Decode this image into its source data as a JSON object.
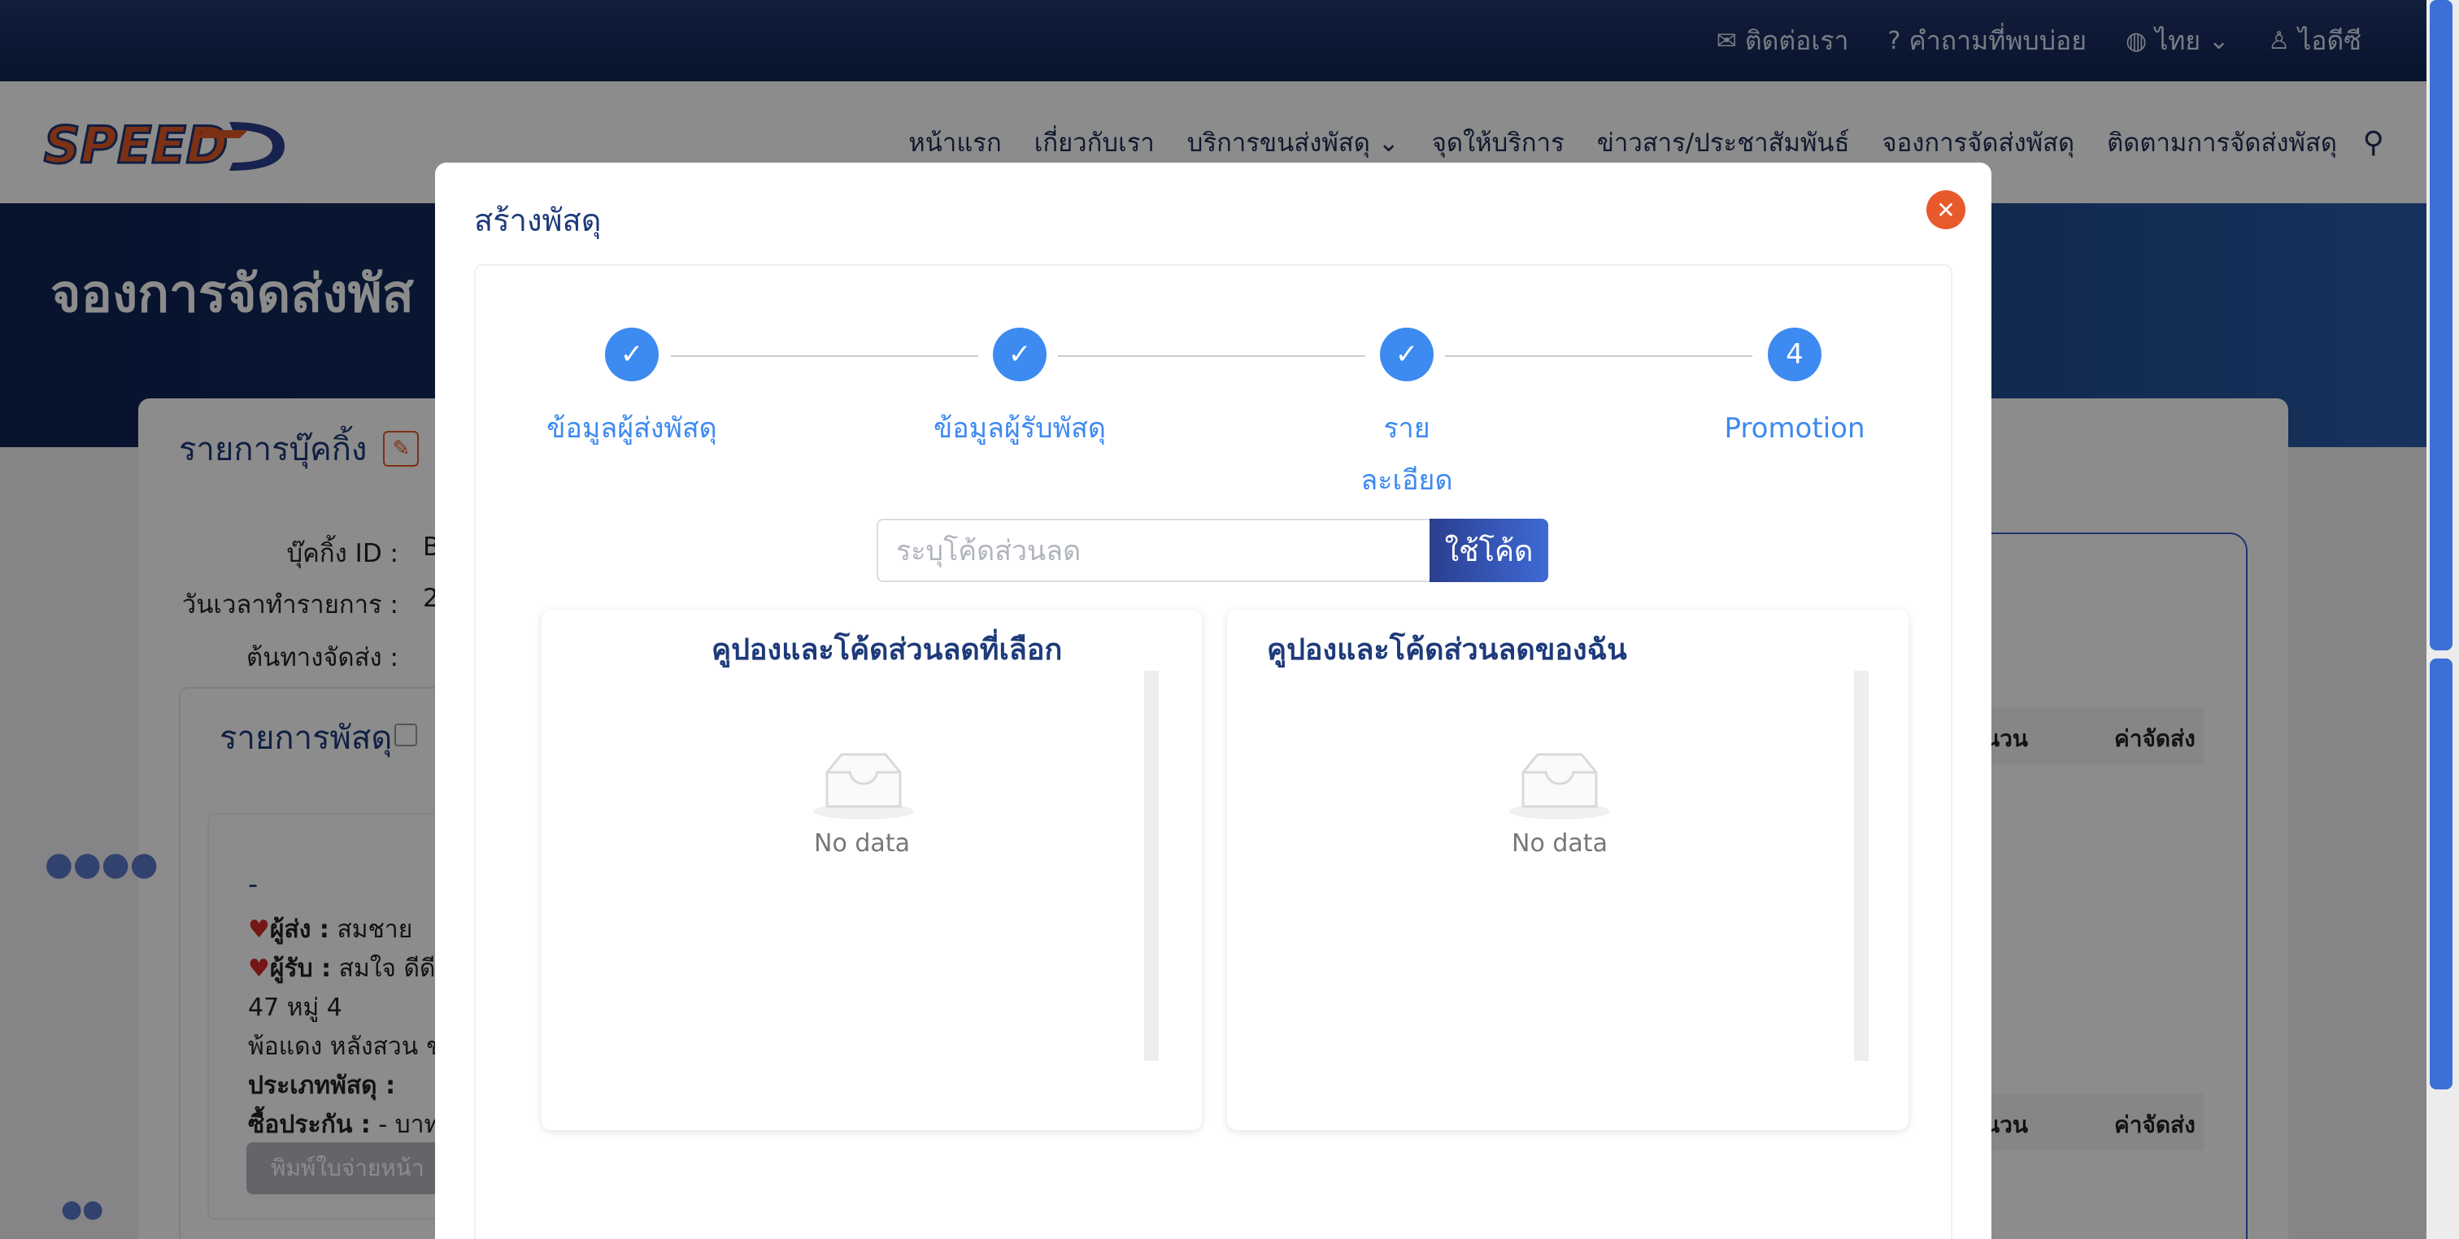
{
  "topbar": {
    "contact": "ติดต่อเรา",
    "faq": "คำถามที่พบบ่อย",
    "language": "ไทย",
    "account": "ไอดีซี"
  },
  "nav": {
    "logo_text": "SPEED-D",
    "items": [
      "หน้าแรก",
      "เกี่ยวกับเรา",
      "บริการขนส่งพัสดุ",
      "จุดให้บริการ",
      "ข่าวสาร/ประชาสัมพันธ์",
      "จองการจัดส่งพัสดุ",
      "ติดตามการจัดส่งพัสดุ"
    ]
  },
  "hero": {
    "title": "จองการจัดส่งพัส"
  },
  "booking": {
    "header": "รายการบุ๊คกิ้ง",
    "labels": [
      "บุ๊คกิ้ง ID :",
      "วันเวลาทำรายการ :",
      "ต้นทางจัดส่ง :"
    ],
    "values": [
      "B",
      "2",
      ""
    ],
    "parcels_title": "รายการพัสดุ",
    "parcel_dash": "-",
    "sender_label": "ผู้ส่ง :",
    "sender_value": "สมชาย",
    "receiver_label": "ผู้รับ :",
    "receiver_value": "สมใจ ดีดี",
    "address_1": "47 หมู่ 4",
    "address_2": "พ้อแดง หลังสวน ช",
    "type_label": "ประเภทพัสดุ :",
    "insurance_label": "ซื้อประกัน :",
    "insurance_value": "- บาท",
    "print_btn": "พิมพ์ใบจ่ายหน้า",
    "col_qty": "นวน",
    "col_fee": "ค่าจัดส่ง"
  },
  "modal": {
    "title": "สร้างพัสดุ",
    "steps": [
      {
        "label": "ข้อมูลผู้ส่งพัสดุ",
        "status": "done"
      },
      {
        "label": "ข้อมูลผู้รับพัสดุ",
        "status": "done"
      },
      {
        "label": "รายละเอียด พัสดุ",
        "status": "done"
      },
      {
        "label": "Promotion",
        "number": "4",
        "status": "active"
      }
    ],
    "promo_placeholder": "ระบุโค้ดส่วนลด",
    "promo_button": "ใช้โค้ด",
    "selected_coupons_title": "คูปองและโค้ดส่วนลดที่เลือก",
    "my_coupons_title": "คูปองและโค้ดส่วนลดของฉัน",
    "empty_text": "No data"
  },
  "colors": {
    "primary_dark": "#0f2453",
    "accent_blue": "#3d8af0",
    "close_orange": "#e8592b"
  }
}
